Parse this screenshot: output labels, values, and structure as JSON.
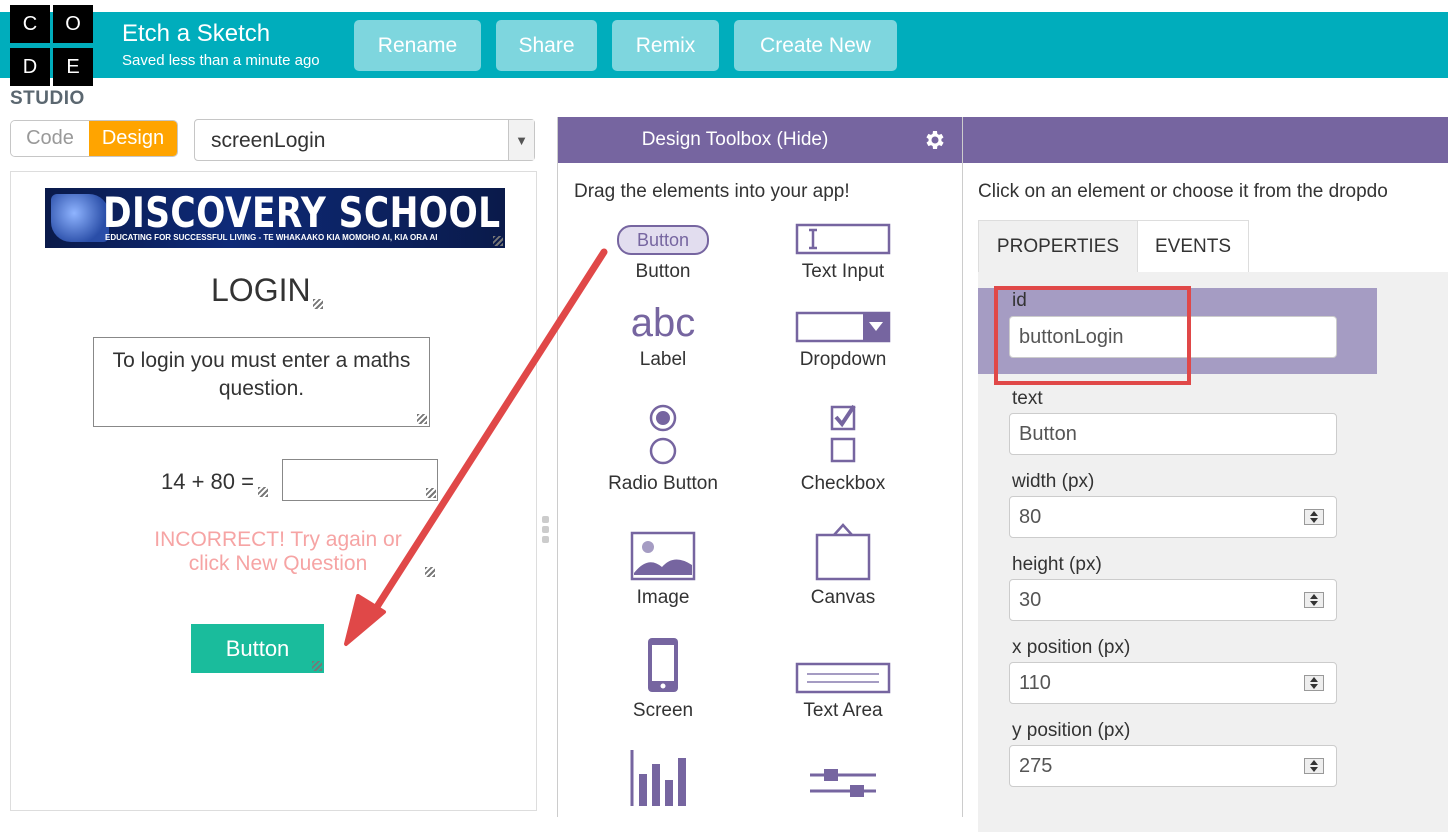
{
  "header": {
    "logo_letters": [
      "C",
      "O",
      "D",
      "E"
    ],
    "studio": "STUDIO",
    "project_title": "Etch a Sketch",
    "saved_status": "Saved less than a minute ago",
    "buttons": [
      "Rename",
      "Share",
      "Remix",
      "Create New"
    ],
    "accent_color": "#00adbc"
  },
  "mode_toggle": {
    "code": "Code",
    "design": "Design"
  },
  "screen_select": {
    "value": "screenLogin"
  },
  "app": {
    "banner_title": "DISCOVERY SCHOOL",
    "banner_subtitle": "EDUCATING FOR SUCCESSFUL LIVING - TE WHAKAAKO KIA MOMOHO AI, KIA ORA AI",
    "login_title": "LOGIN",
    "info_text": "To login you must enter a maths question.",
    "math_label": "14 + 80 =",
    "math_input_value": "",
    "incorrect_text": "INCORRECT! Try again or click New Question",
    "button_label": "Button"
  },
  "toolbox": {
    "title": "Design Toolbox (Hide)",
    "hint": "Drag the elements into your app!",
    "items": [
      {
        "label": "Button",
        "icon": "button-icon",
        "icon_text": "Button"
      },
      {
        "label": "Text Input",
        "icon": "text-input-icon"
      },
      {
        "label": "Label",
        "icon": "label-icon",
        "icon_text": "abc"
      },
      {
        "label": "Dropdown",
        "icon": "dropdown-icon"
      },
      {
        "label": "Radio Button",
        "icon": "radio-button-icon"
      },
      {
        "label": "Checkbox",
        "icon": "checkbox-icon"
      },
      {
        "label": "Image",
        "icon": "image-icon"
      },
      {
        "label": "Canvas",
        "icon": "canvas-icon"
      },
      {
        "label": "Screen",
        "icon": "screen-icon"
      },
      {
        "label": "Text Area",
        "icon": "text-area-icon"
      }
    ]
  },
  "properties": {
    "hint": "Click on an element or choose it from the dropdo",
    "tabs": [
      "PROPERTIES",
      "EVENTS"
    ],
    "fields": [
      {
        "label": "id",
        "value": "buttonLogin"
      },
      {
        "label": "text",
        "value": "Button"
      },
      {
        "label": "width (px)",
        "value": "80"
      },
      {
        "label": "height (px)",
        "value": "30"
      },
      {
        "label": "x position (px)",
        "value": "110"
      },
      {
        "label": "y position (px)",
        "value": "275"
      }
    ]
  }
}
